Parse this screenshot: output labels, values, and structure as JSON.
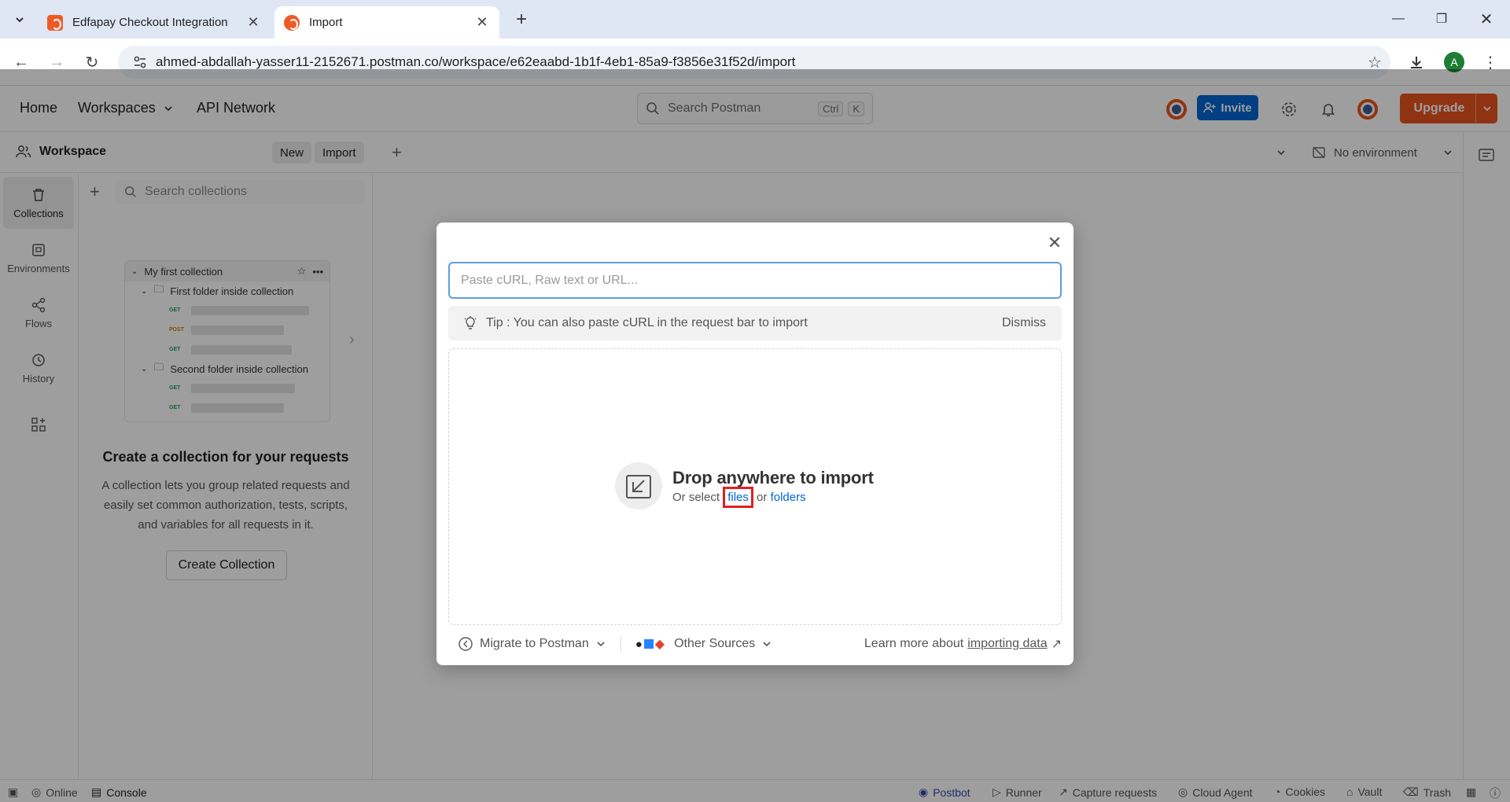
{
  "browser": {
    "tabs": [
      {
        "title": "Edfapay Checkout Integration"
      },
      {
        "title": "Import"
      }
    ],
    "url": "ahmed-abdallah-yasser11-2152671.postman.co/workspace/e62eaabd-1b1f-4eb1-85a9-f3856e31f52d/import",
    "profile_initial": "A"
  },
  "header": {
    "home": "Home",
    "workspaces": "Workspaces",
    "api_network": "API Network",
    "search_placeholder": "Search Postman",
    "search_shortcut_1": "Ctrl",
    "search_shortcut_2": "K",
    "invite": "Invite",
    "upgrade": "Upgrade"
  },
  "workspace_bar": {
    "title": "Workspace",
    "new": "New",
    "import": "Import",
    "environment": "No environment"
  },
  "rail": {
    "items": [
      {
        "label": "Collections"
      },
      {
        "label": "Environments"
      },
      {
        "label": "Flows"
      },
      {
        "label": "History"
      }
    ]
  },
  "sidebar": {
    "search_placeholder": "Search collections",
    "illustration": {
      "collection": "My first collection",
      "folder1": "First folder inside collection",
      "folder2": "Second folder inside collection",
      "methods": [
        "GET",
        "POST",
        "GET",
        "GET",
        "GET"
      ]
    },
    "empty_title": "Create a collection for your requests",
    "empty_desc": "A collection lets you group related requests and easily set common authorization, tests, scripts, and variables for all requests in it.",
    "create_button": "Create Collection"
  },
  "modal": {
    "input_placeholder": "Paste cURL, Raw text or URL...",
    "tip": "Tip : You can also paste cURL in the request bar to import",
    "dismiss": "Dismiss",
    "drop_title": "Drop anywhere to import",
    "drop_prefix": "Or select",
    "files": "files",
    "or": "or",
    "folders": "folders",
    "migrate": "Migrate to Postman",
    "other_sources": "Other Sources",
    "learn_prefix": "Learn more about",
    "learn_link": "importing data"
  },
  "statusbar": {
    "online": "Online",
    "console": "Console",
    "postbot": "Postbot",
    "runner": "Runner",
    "capture": "Capture requests",
    "cloud_agent": "Cloud Agent",
    "cookies": "Cookies",
    "vault": "Vault",
    "trash": "Trash"
  },
  "colors": {
    "accent": "#e8531e",
    "link": "#0265d2",
    "highlight": "#e02020"
  }
}
